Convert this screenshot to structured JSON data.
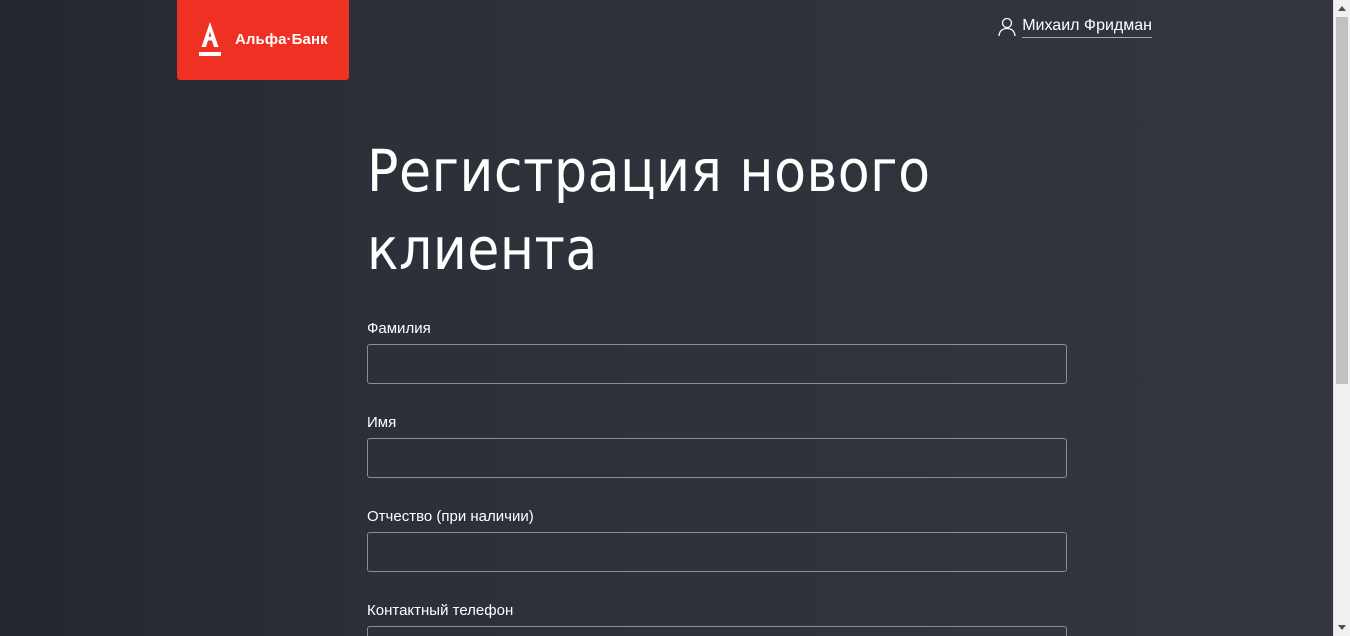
{
  "header": {
    "logo_text": "Альфа·Банк",
    "logo_color": "#ef3124",
    "user_icon": "user-icon",
    "user_name": "Михаил Фридман"
  },
  "main": {
    "title_line1": "Регистрация нового",
    "title_line2": "клиента",
    "fields": [
      {
        "label": "Фамилия",
        "value": "",
        "placeholder": ""
      },
      {
        "label": "Имя",
        "value": "",
        "placeholder": ""
      },
      {
        "label": "Отчество (при наличии)",
        "value": "",
        "placeholder": ""
      },
      {
        "label": "Контактный телефон",
        "value": "",
        "placeholder": ""
      }
    ]
  },
  "colors": {
    "background": "#2c3038",
    "accent": "#ef3124",
    "input_border": "#8a8e96"
  }
}
